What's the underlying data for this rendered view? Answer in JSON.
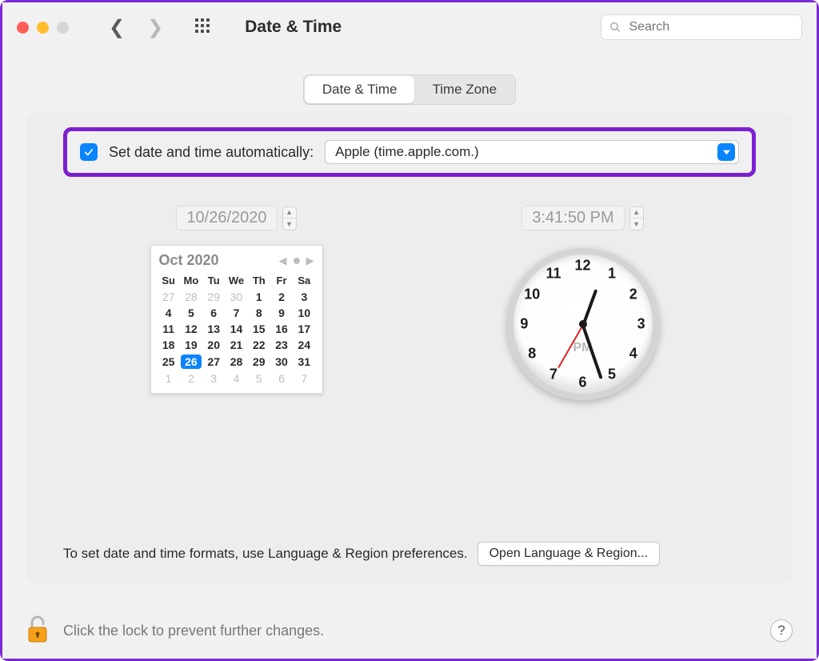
{
  "toolbar": {
    "title": "Date & Time",
    "search_placeholder": "Search"
  },
  "tabs": {
    "items": [
      "Date & Time",
      "Time Zone"
    ],
    "active_index": 0
  },
  "auto_row": {
    "label": "Set date and time automatically:",
    "checked": true,
    "server": "Apple (time.apple.com.)"
  },
  "date_field": {
    "value": "10/26/2020"
  },
  "time_field": {
    "value": "3:41:50 PM"
  },
  "calendar": {
    "month_label": "Oct 2020",
    "weekdays": [
      "Su",
      "Mo",
      "Tu",
      "We",
      "Th",
      "Fr",
      "Sa"
    ],
    "weeks": [
      [
        {
          "d": "27",
          "out": true
        },
        {
          "d": "28",
          "out": true
        },
        {
          "d": "29",
          "out": true
        },
        {
          "d": "30",
          "out": true
        },
        {
          "d": "1"
        },
        {
          "d": "2"
        },
        {
          "d": "3"
        }
      ],
      [
        {
          "d": "4"
        },
        {
          "d": "5"
        },
        {
          "d": "6"
        },
        {
          "d": "7"
        },
        {
          "d": "8"
        },
        {
          "d": "9"
        },
        {
          "d": "10"
        }
      ],
      [
        {
          "d": "11"
        },
        {
          "d": "12"
        },
        {
          "d": "13"
        },
        {
          "d": "14"
        },
        {
          "d": "15"
        },
        {
          "d": "16"
        },
        {
          "d": "17"
        }
      ],
      [
        {
          "d": "18"
        },
        {
          "d": "19"
        },
        {
          "d": "20"
        },
        {
          "d": "21"
        },
        {
          "d": "22"
        },
        {
          "d": "23"
        },
        {
          "d": "24"
        }
      ],
      [
        {
          "d": "25"
        },
        {
          "d": "26",
          "sel": true
        },
        {
          "d": "27"
        },
        {
          "d": "28"
        },
        {
          "d": "29"
        },
        {
          "d": "30"
        },
        {
          "d": "31"
        }
      ],
      [
        {
          "d": "1",
          "out": true
        },
        {
          "d": "2",
          "out": true
        },
        {
          "d": "3",
          "out": true
        },
        {
          "d": "4",
          "out": true
        },
        {
          "d": "5",
          "out": true
        },
        {
          "d": "6",
          "out": true
        },
        {
          "d": "7",
          "out": true
        }
      ]
    ]
  },
  "clock": {
    "ampm": "PM",
    "hour_angle": 20,
    "minute_angle": 161,
    "second_angle": 210
  },
  "content_bottom": {
    "text": "To set date and time formats, use Language & Region preferences.",
    "button": "Open Language & Region..."
  },
  "footer": {
    "text": "Click the lock to prevent further changes.",
    "help": "?"
  }
}
